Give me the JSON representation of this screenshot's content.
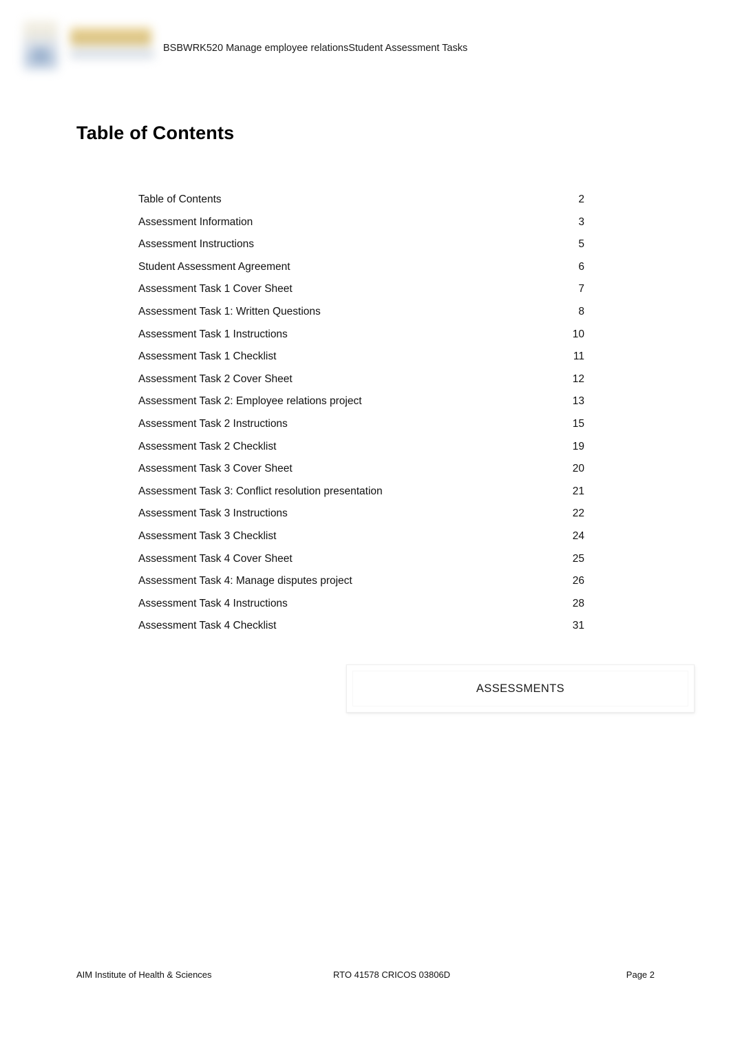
{
  "header": {
    "text": "BSBWRK520 Manage employee relationsStudent Assessment Tasks",
    "logo_name": "aim-institute-logo"
  },
  "title": "Table of Contents",
  "toc": {
    "entries": [
      {
        "label": "Table of Contents",
        "page": "2"
      },
      {
        "label": "Assessment Information",
        "page": "3"
      },
      {
        "label": "Assessment Instructions",
        "page": "5"
      },
      {
        "label": "Student Assessment Agreement",
        "page": "6"
      },
      {
        "label": "Assessment Task 1 Cover Sheet",
        "page": "7"
      },
      {
        "label": "Assessment Task 1: Written Questions",
        "page": "8"
      },
      {
        "label": "Assessment Task 1 Instructions",
        "page": "10"
      },
      {
        "label": "Assessment Task 1 Checklist",
        "page": "11"
      },
      {
        "label": "Assessment Task 2 Cover Sheet",
        "page": "12"
      },
      {
        "label": "Assessment Task 2: Employee relations project",
        "page": "13"
      },
      {
        "label": "Assessment Task 2 Instructions",
        "page": "15"
      },
      {
        "label": "Assessment Task 2 Checklist",
        "page": "19"
      },
      {
        "label": "Assessment Task 3 Cover Sheet",
        "page": "20"
      },
      {
        "label": "Assessment Task 3: Conflict resolution presentation",
        "page": "21"
      },
      {
        "label": "Assessment Task 3 Instructions",
        "page": "22"
      },
      {
        "label": "Assessment Task 3 Checklist",
        "page": "24"
      },
      {
        "label": "Assessment Task 4 Cover Sheet",
        "page": "25"
      },
      {
        "label": "Assessment Task 4: Manage disputes project",
        "page": "26"
      },
      {
        "label": "Assessment Task 4 Instructions",
        "page": "28"
      },
      {
        "label": "Assessment Task 4 Checklist",
        "page": "31"
      }
    ]
  },
  "assessments_box": {
    "label": "ASSESSMENTS"
  },
  "footer": {
    "left": "AIM Institute of Health & Sciences",
    "center": "RTO 41578  CRICOS 03806D",
    "right": "Page 2"
  }
}
